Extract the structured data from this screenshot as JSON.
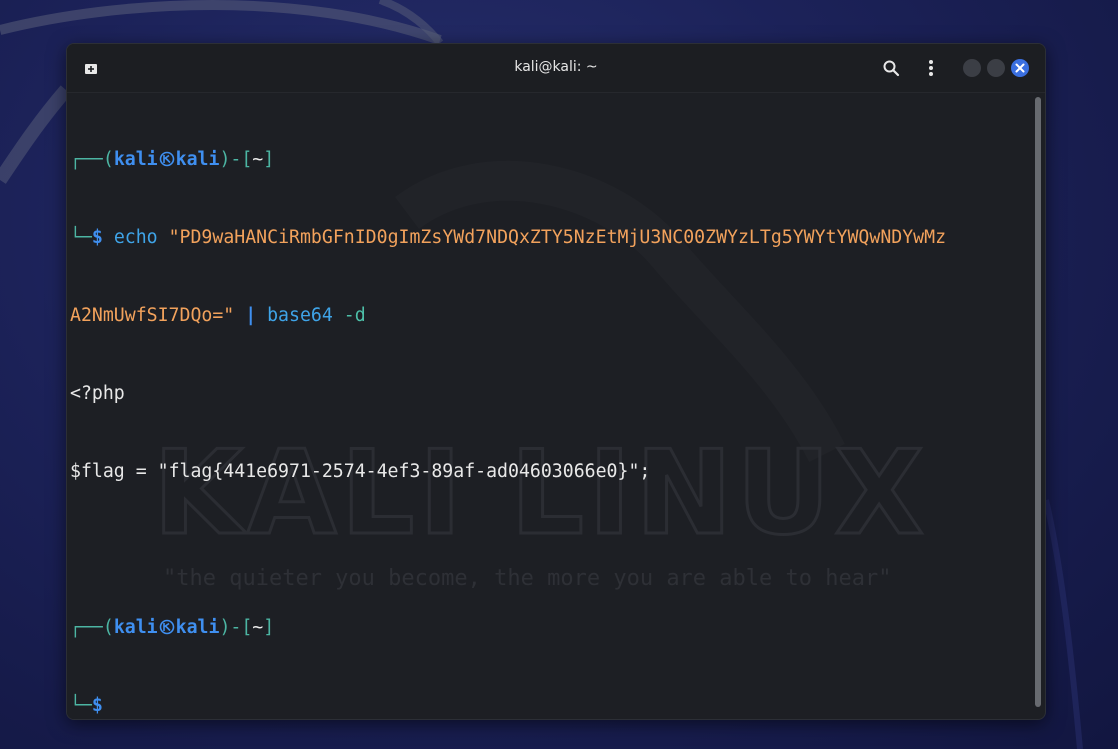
{
  "window": {
    "title": "kali@kali: ~"
  },
  "icons": {
    "new_tab": "new-tab-icon",
    "search": "search-icon",
    "menu": "kebab-menu-icon",
    "minimize": "minimize-icon",
    "maximize": "maximize-icon",
    "close": "close-icon",
    "kali_logo": "kali-dragon-icon"
  },
  "colors": {
    "accent": "#3f8ff0",
    "prompt_frame": "#4cb5a3",
    "string": "#f2a25c",
    "background": "#1d1f24"
  },
  "watermark": {
    "logo_text": "KALI LINUX",
    "tagline": "\"the quieter you become, the more you are able to hear\""
  },
  "terminal": {
    "prompt1": {
      "frame_top": "┌──(",
      "user": "kali",
      "host": "kali",
      "frame_mid": ")-[",
      "dir": "~",
      "frame_end": "]",
      "frame_bottom": "└─",
      "dollar": "$"
    },
    "command": {
      "echo": "echo",
      "arg_line1": "\"PD9waHANCiRmbGFnID0gImZsYWd7NDQxZTY5NzEtMjU3NC00ZWYzLTg5YWYtYWQwNDYwMz",
      "arg_line2": "A2NmUwfSI7DQo=\"",
      "pipe": "|",
      "cmd2": "base64",
      "flag2": "-d"
    },
    "output": {
      "line1": "<?php",
      "line2_var": "$flag = \"",
      "line2_flag": "flag{441e6971-2574-4ef3-89af-ad04603066e0}",
      "line2_end": "\";"
    },
    "prompt2": {
      "frame_top": "┌──(",
      "user": "kali",
      "host": "kali",
      "frame_mid": ")-[",
      "dir": "~",
      "frame_end": "]",
      "frame_bottom": "└─",
      "dollar": "$"
    }
  }
}
